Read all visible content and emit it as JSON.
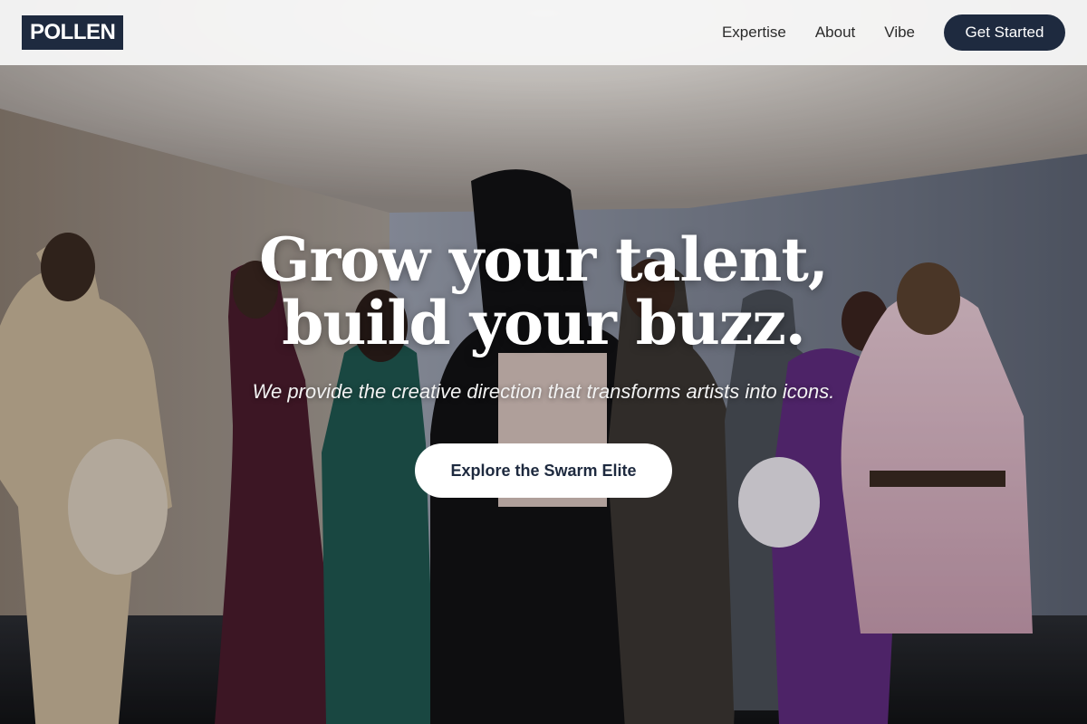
{
  "brand": {
    "logo_text": "POLLEN"
  },
  "nav": {
    "links": [
      "Expertise",
      "About",
      "Vibe"
    ],
    "cta_label": "Get Started"
  },
  "hero": {
    "headline": "Grow your talent, build your buzz.",
    "subheadline": "We provide the creative direction that transforms artists into icons.",
    "button_label": "Explore the Swarm Elite",
    "background_image": "photo-of-fashion-models-group-in-gallery-room"
  },
  "colors": {
    "navy": "#1e2a3f",
    "white": "#ffffff",
    "nav_bg": "#f6f6f6"
  }
}
